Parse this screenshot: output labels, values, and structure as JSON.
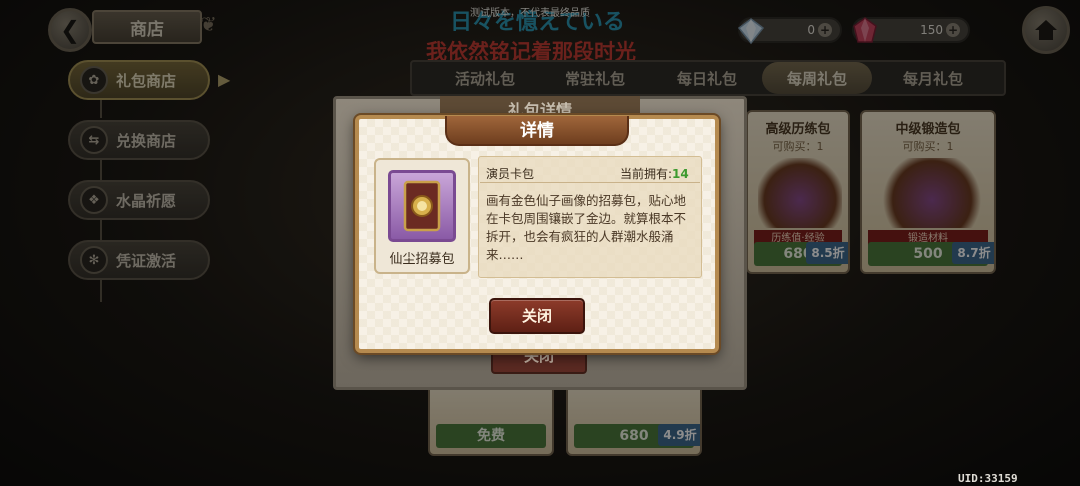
{
  "header": {
    "back_icon": "back-arrow-icon",
    "title": "商店",
    "test_notice": "测试版本，不代表最终品质",
    "lyric_jp": "日々を憶えている",
    "lyric_cn": "我依然铭记着那段时光",
    "currency": [
      {
        "name": "diamond",
        "value": "0",
        "icon": "diamond-icon"
      },
      {
        "name": "crystal",
        "value": "150",
        "icon": "crystal-icon"
      }
    ],
    "home_icon": "home-icon"
  },
  "sidebar": {
    "items": [
      {
        "label": "礼包商店",
        "icon": "gift-icon",
        "active": true
      },
      {
        "label": "兑换商店",
        "icon": "exchange-icon",
        "active": false
      },
      {
        "label": "水晶祈愿",
        "icon": "crystal-wish-icon",
        "active": false
      },
      {
        "label": "凭证激活",
        "icon": "voucher-icon",
        "active": false
      }
    ]
  },
  "tabs": [
    {
      "label": "活动礼包"
    },
    {
      "label": "常驻礼包"
    },
    {
      "label": "每日礼包"
    },
    {
      "label": "每周礼包",
      "active": true
    },
    {
      "label": "每月礼包"
    }
  ],
  "cards": [
    {
      "title": "高级历练包",
      "sub": "可购买：1",
      "cap": "历练值·经验",
      "price": "680",
      "discount": "8.5折"
    },
    {
      "title": "中级锻造包",
      "sub": "可购买：1",
      "cap": "锻造材料",
      "price": "500",
      "discount": "8.7折"
    },
    {
      "title": "",
      "sub": "",
      "cap": "",
      "price": "免费",
      "discount": ""
    },
    {
      "title": "",
      "sub": "",
      "cap": "",
      "price": "680",
      "discount": "4.9折"
    }
  ],
  "back_panel": {
    "title": "礼包详情",
    "close_label": "关闭"
  },
  "dialog": {
    "title": "详情",
    "item": {
      "name": "仙尘招募包",
      "icon": "card-pack-icon",
      "type": "演员卡包",
      "owned_label": "当前拥有:",
      "owned_value": "14",
      "description": "画有金色仙子画像的招募包，贴心地在卡包周围镶嵌了金边。就算根本不拆开，也会有疯狂的人群潮水般涌来……"
    },
    "close_label": "关闭"
  },
  "uid": "UID:33159",
  "colors": {
    "accent_gold": "#b58a4f",
    "close_button": "#8d3b2a",
    "owned_value": "#3d9a2f"
  }
}
